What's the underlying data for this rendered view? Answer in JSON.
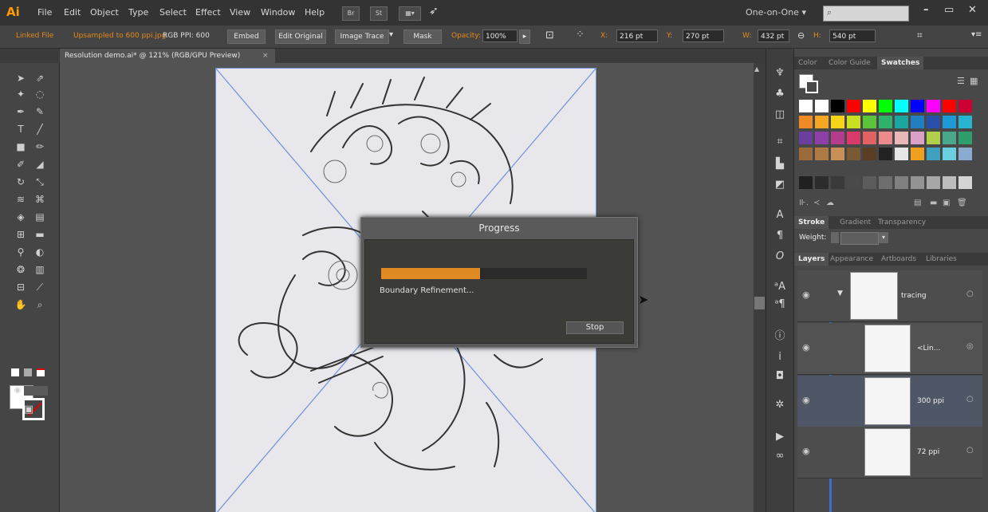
{
  "menubar": {
    "app_logo": "Ai",
    "items": [
      "File",
      "Edit",
      "Object",
      "Type",
      "Select",
      "Effect",
      "View",
      "Window",
      "Help"
    ],
    "bridge": "Br",
    "stock": "St",
    "workspace": "One-on-One",
    "search_placeholder": ""
  },
  "controlbar": {
    "linked_file": "Linked File",
    "upsampled": "Upsampled to 600 ppi.jpg",
    "rgb_ppi": "RGB  PPI: 600",
    "embed": "Embed",
    "edit_original": "Edit Original",
    "image_trace": "Image Trace",
    "mask": "Mask",
    "opacity_label": "Opacity:",
    "opacity_value": "100%",
    "x_label": "X:",
    "x_value": "216 pt",
    "y_label": "Y:",
    "y_value": "270 pt",
    "w_label": "W:",
    "w_value": "432 pt",
    "h_label": "H:",
    "h_value": "540 pt"
  },
  "document": {
    "tab_title": "Resolution demo.ai* @ 121% (RGB/GPU Preview)",
    "tab_close": "×"
  },
  "progress_dialog": {
    "title": "Progress",
    "progress_fraction": 0.48,
    "status": "Boundary Refinement...",
    "stop_label": "Stop"
  },
  "panels": {
    "top_tabs": [
      "Color",
      "Color Guide",
      "Swatches"
    ],
    "stroke_tabs": [
      "Stroke",
      "Gradient",
      "Transparency"
    ],
    "weight_label": "Weight:",
    "layer_tabs": [
      "Layers",
      "Appearance",
      "Artboards",
      "Libraries"
    ],
    "layers": [
      {
        "name": "tracing"
      },
      {
        "name": "<Lin..."
      },
      {
        "name": "300 ppi"
      },
      {
        "name": "72 ppi"
      }
    ],
    "swatch_rows": [
      [
        "#ffffff",
        "#ffffff",
        "#000000",
        "#ff0000",
        "#ffff00",
        "#00ff00",
        "#00ffff",
        "#0000ff",
        "#ff00ff",
        "#ff0000",
        "#cc0033"
      ],
      [
        "#f08a24",
        "#f5a623",
        "#f7d417",
        "#c8e020",
        "#5ac43a",
        "#2fb36b",
        "#1aa7a0",
        "#1f7fc1",
        "#2a4fa8",
        "#1e9bd6",
        "#27b5d1"
      ],
      [
        "#6a3fa0",
        "#8e3fa8",
        "#b53b8c",
        "#d93a6a",
        "#e06262",
        "#ec8b8b",
        "#e8b7b7",
        "#d9a0c8",
        "#b0d04a",
        "#49a88c",
        "#2e9e6d"
      ],
      [
        "#9c6b3a",
        "#b07b42",
        "#c89056",
        "#7a5a35",
        "#5a3d22",
        "#222222",
        "#e6e6e6",
        "#f0a020",
        "#3fa0c0",
        "#6ad0e0",
        "#8aaad0"
      ]
    ],
    "gray_row": [
      "#202020",
      "#2c2c2c",
      "#3a3a3a",
      "#4a4a4a",
      "#5c5c5c",
      "#6e6e6e",
      "#808080",
      "#939393",
      "#a7a7a7",
      "#bcbcbc",
      "#d4d4d4"
    ]
  },
  "colors": {
    "accent_orange": "#e08a24",
    "selection_blue": "#3d6fcf"
  }
}
